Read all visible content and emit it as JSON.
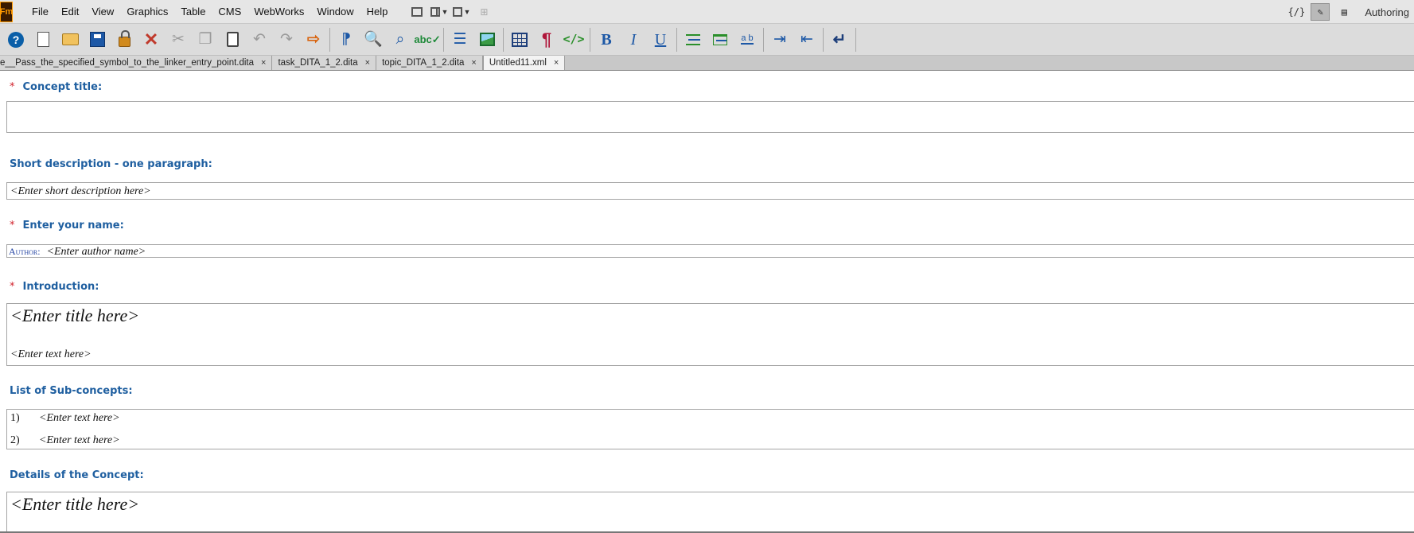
{
  "app": {
    "logo_text": "Fm",
    "mode_label": "Authoring"
  },
  "menu": [
    "File",
    "Edit",
    "View",
    "Graphics",
    "Table",
    "CMS",
    "WebWorks",
    "Window",
    "Help"
  ],
  "tabs": [
    {
      "label": "e__Pass_the_specified_symbol_to_the_linker_entry_point.dita",
      "active": false
    },
    {
      "label": "task_DITA_1_2.dita",
      "active": false
    },
    {
      "label": "topic_DITA_1_2.dita",
      "active": false
    },
    {
      "label": "Untitled11.xml",
      "active": true
    }
  ],
  "tab_close_glyph": "×",
  "required_marker": "*",
  "form": {
    "concept_title": {
      "label": "Concept title:",
      "required": true,
      "value": ""
    },
    "short_description": {
      "label": "Short description - one paragraph:",
      "required": false,
      "placeholder": "<Enter short description here>"
    },
    "author": {
      "label": "Enter your name:",
      "required": true,
      "tag": "Author:",
      "placeholder": "<Enter author name>"
    },
    "introduction": {
      "label": "Introduction:",
      "required": true,
      "title_placeholder": "<Enter title here>",
      "text_placeholder": "<Enter text here>"
    },
    "sub_concepts": {
      "label": "List of Sub-concepts:",
      "required": false,
      "items": [
        {
          "num": "1)",
          "text": "<Enter text here>"
        },
        {
          "num": "2)",
          "text": "<Enter text here>"
        }
      ]
    },
    "details": {
      "label": "Details of the Concept:",
      "required": false,
      "title_placeholder": "<Enter title here>"
    }
  },
  "colors": {
    "label_blue": "#1f5fa0",
    "required_red": "#d0202a",
    "toolbar_bg": "#dcdcdc",
    "menu_bg": "#e6e6e6"
  }
}
